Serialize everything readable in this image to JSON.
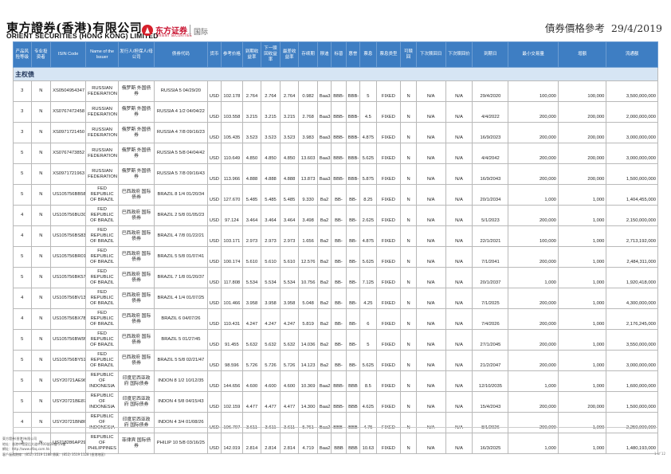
{
  "brand": {
    "name_cn": "東方證券(香港)有限公司",
    "name_en": "ORIENT SECURITIES (HONG KONG) LIMITED",
    "partner_cn": "东方证券",
    "partner_sub": "ORIENT SECURITIES",
    "intl": "国际"
  },
  "title": {
    "text": "債券價格參考",
    "date": "29/4/2019"
  },
  "columns": [
    "产品风险等级",
    "专业投资者",
    "ISIN Code",
    "Name of the Issuer",
    "发行人/担保人/母公司",
    "债券代码",
    "货币",
    "参考价格",
    "到期收益率",
    "下一赎回收益率",
    "最差收益率",
    "存续期",
    "穆迪",
    "标普",
    "惠誉",
    "票息",
    "票息类型",
    "可赎回",
    "下次赎回日",
    "下次赎回价",
    "到期日",
    "最小交易量",
    "增额",
    "流通额"
  ],
  "section": "主权债",
  "rows": [
    {
      "risk": "3",
      "pro": "N",
      "isin": "XS0504954347",
      "issuer": "RUSSIAN FEDERATION",
      "guarantor": "俄罗斯 外国债券",
      "ticker": "RUSSIA 5 04/29/20",
      "ccy": "USD",
      "price": "102.178",
      "ytm": "2.764",
      "ytc": "2.764",
      "ytw": "2.764",
      "dur": "0.982",
      "moody": "Baa3",
      "sp": "BBB-",
      "fitch": "BBB-",
      "cpn": "5",
      "ctype": "FIXED",
      "call": "N",
      "ncd": "N/A",
      "ncp": "N/A",
      "mat": "29/4/2020",
      "min": "100,000",
      "inc": "100,000",
      "out": "3,500,000,000"
    },
    {
      "risk": "3",
      "pro": "N",
      "isin": "XS0767472458",
      "issuer": "RUSSIAN FEDERATION",
      "guarantor": "俄罗斯 外国债券",
      "ticker": "RUSSIA 4 1/2 04/04/22",
      "ccy": "USD",
      "price": "103.558",
      "ytm": "3.215",
      "ytc": "3.215",
      "ytw": "3.215",
      "dur": "2.768",
      "moody": "Baa3",
      "sp": "BBB-",
      "fitch": "BBB-",
      "cpn": "4.5",
      "ctype": "FIXED",
      "call": "N",
      "ncd": "N/A",
      "ncp": "N/A",
      "mat": "4/4/2022",
      "min": "200,000",
      "inc": "200,000",
      "out": "2,000,000,000"
    },
    {
      "risk": "3",
      "pro": "N",
      "isin": "XS0971721450",
      "issuer": "RUSSIAN FEDERATION",
      "guarantor": "俄罗斯 外国债券",
      "ticker": "RUSSIA 4 7/8 09/16/23",
      "ccy": "USD",
      "price": "105.435",
      "ytm": "3.523",
      "ytc": "3.523",
      "ytw": "3.523",
      "dur": "3.983",
      "moody": "Baa3",
      "sp": "BBB-",
      "fitch": "BBB-",
      "cpn": "4.875",
      "ctype": "FIXED",
      "call": "N",
      "ncd": "N/A",
      "ncp": "N/A",
      "mat": "16/9/2023",
      "min": "200,000",
      "inc": "200,000",
      "out": "3,000,000,000"
    },
    {
      "risk": "5",
      "pro": "N",
      "isin": "XS0767473852",
      "issuer": "RUSSIAN FEDERATION",
      "guarantor": "俄罗斯 外国债券",
      "ticker": "RUSSIA 5 5/8 04/04/42",
      "ccy": "USD",
      "price": "110.649",
      "ytm": "4.850",
      "ytc": "4.850",
      "ytw": "4.850",
      "dur": "13.603",
      "moody": "Baa3",
      "sp": "BBB-",
      "fitch": "BBB-",
      "cpn": "5.625",
      "ctype": "FIXED",
      "call": "N",
      "ncd": "N/A",
      "ncp": "N/A",
      "mat": "4/4/2042",
      "min": "200,000",
      "inc": "200,000",
      "out": "3,000,000,000"
    },
    {
      "risk": "5",
      "pro": "N",
      "isin": "XS0971721963",
      "issuer": "RUSSIAN FEDERATION",
      "guarantor": "俄罗斯 外国债券",
      "ticker": "RUSSIA 5 7/8 09/16/43",
      "ccy": "USD",
      "price": "113.966",
      "ytm": "4.888",
      "ytc": "4.888",
      "ytw": "4.888",
      "dur": "13.873",
      "moody": "Baa3",
      "sp": "BBB-",
      "fitch": "BBB-",
      "cpn": "5.875",
      "ctype": "FIXED",
      "call": "N",
      "ncd": "N/A",
      "ncp": "N/A",
      "mat": "16/9/2043",
      "min": "200,000",
      "inc": "200,000",
      "out": "1,500,000,000"
    },
    {
      "risk": "5",
      "pro": "N",
      "isin": "US105756BB58",
      "issuer": "FED REPUBLIC OF BRAZIL",
      "guarantor": "巴西政府 国际债券",
      "ticker": "BRAZIL 8 1/4 01/20/34",
      "ccy": "USD",
      "price": "127.670",
      "ytm": "5.485",
      "ytc": "5.485",
      "ytw": "5.485",
      "dur": "9.330",
      "moody": "Ba2",
      "sp": "BB-",
      "fitch": "BB-",
      "cpn": "8.25",
      "ctype": "FIXED",
      "call": "N",
      "ncd": "N/A",
      "ncp": "N/A",
      "mat": "20/1/2034",
      "min": "1,000",
      "inc": "1,000",
      "out": "1,404,455,000"
    },
    {
      "risk": "4",
      "pro": "N",
      "isin": "US105756BU30",
      "issuer": "FED REPUBLIC OF BRAZIL",
      "guarantor": "巴西政府 国际债券",
      "ticker": "BRAZIL 2 5/8 01/05/23",
      "ccy": "USD",
      "price": "97.124",
      "ytm": "3.464",
      "ytc": "3.464",
      "ytw": "3.464",
      "dur": "3.498",
      "moody": "Ba2",
      "sp": "BB-",
      "fitch": "BB-",
      "cpn": "2.625",
      "ctype": "FIXED",
      "call": "N",
      "ncd": "N/A",
      "ncp": "N/A",
      "mat": "5/1/2023",
      "min": "200,000",
      "inc": "1,000",
      "out": "2,150,000,000"
    },
    {
      "risk": "4",
      "pro": "N",
      "isin": "US105756BS83",
      "issuer": "FED REPUBLIC OF BRAZIL",
      "guarantor": "巴西政府 国际债券",
      "ticker": "BRAZIL 4 7/8 01/22/21",
      "ccy": "USD",
      "price": "103.171",
      "ytm": "2.973",
      "ytc": "2.973",
      "ytw": "2.973",
      "dur": "1.656",
      "moody": "Ba2",
      "sp": "BB-",
      "fitch": "BB-",
      "cpn": "4.875",
      "ctype": "FIXED",
      "call": "N",
      "ncd": "N/A",
      "ncp": "N/A",
      "mat": "22/1/2021",
      "min": "100,000",
      "inc": "1,000",
      "out": "2,713,192,000"
    },
    {
      "risk": "5",
      "pro": "N",
      "isin": "US105756BR01",
      "issuer": "FED REPUBLIC OF BRAZIL",
      "guarantor": "巴西政府 国际债券",
      "ticker": "BRAZIL 5 5/8 01/07/41",
      "ccy": "USD",
      "price": "100.174",
      "ytm": "5.610",
      "ytc": "5.610",
      "ytw": "5.610",
      "dur": "12.576",
      "moody": "Ba2",
      "sp": "BB-",
      "fitch": "BB-",
      "cpn": "5.625",
      "ctype": "FIXED",
      "call": "N",
      "ncd": "N/A",
      "ncp": "N/A",
      "mat": "7/1/2041",
      "min": "200,000",
      "inc": "1,000",
      "out": "2,484,311,000"
    },
    {
      "risk": "5",
      "pro": "N",
      "isin": "US105756BK57",
      "issuer": "FED REPUBLIC OF BRAZIL",
      "guarantor": "巴西政府 国际债券",
      "ticker": "BRAZIL 7 1/8 01/20/37",
      "ccy": "USD",
      "price": "117.808",
      "ytm": "5.534",
      "ytc": "5.534",
      "ytw": "5.534",
      "dur": "10.756",
      "moody": "Ba2",
      "sp": "BB-",
      "fitch": "BB-",
      "cpn": "7.125",
      "ctype": "FIXED",
      "call": "N",
      "ncd": "N/A",
      "ncp": "N/A",
      "mat": "20/1/2037",
      "min": "1,000",
      "inc": "1,000",
      "out": "1,920,418,000"
    },
    {
      "risk": "4",
      "pro": "N",
      "isin": "US105756BV13",
      "issuer": "FED REPUBLIC OF BRAZIL",
      "guarantor": "巴西政府 国际债券",
      "ticker": "BRAZIL 4 1/4 01/07/25",
      "ccy": "USD",
      "price": "101.466",
      "ytm": "3.958",
      "ytc": "3.958",
      "ytw": "3.958",
      "dur": "5.048",
      "moody": "Ba2",
      "sp": "BB-",
      "fitch": "BB-",
      "cpn": "4.25",
      "ctype": "FIXED",
      "call": "N",
      "ncd": "N/A",
      "ncp": "N/A",
      "mat": "7/1/2025",
      "min": "200,000",
      "inc": "1,000",
      "out": "4,300,000,000"
    },
    {
      "risk": "4",
      "pro": "N",
      "isin": "US105756BX78",
      "issuer": "FED REPUBLIC OF BRAZIL",
      "guarantor": "巴西政府 国际债券",
      "ticker": "BRAZIL 6 04/07/26",
      "ccy": "USD",
      "price": "110.431",
      "ytm": "4.247",
      "ytc": "4.247",
      "ytw": "4.247",
      "dur": "5.819",
      "moody": "Ba2",
      "sp": "BB-",
      "fitch": "BB-",
      "cpn": "6",
      "ctype": "FIXED",
      "call": "N",
      "ncd": "N/A",
      "ncp": "N/A",
      "mat": "7/4/2026",
      "min": "200,000",
      "inc": "1,000",
      "out": "2,176,245,000"
    },
    {
      "risk": "5",
      "pro": "N",
      "isin": "US105756BW95",
      "issuer": "FED REPUBLIC OF BRAZIL",
      "guarantor": "巴西政府 国际债券",
      "ticker": "BRAZIL 5 01/27/45",
      "ccy": "USD",
      "price": "91.455",
      "ytm": "5.632",
      "ytc": "5.632",
      "ytw": "5.632",
      "dur": "14.036",
      "moody": "Ba2",
      "sp": "BB-",
      "fitch": "BB-",
      "cpn": "5",
      "ctype": "FIXED",
      "call": "N",
      "ncd": "N/A",
      "ncp": "N/A",
      "mat": "27/1/2045",
      "min": "200,000",
      "inc": "1,000",
      "out": "3,550,000,000"
    },
    {
      "risk": "5",
      "pro": "N",
      "isin": "US105756BY51",
      "issuer": "FED REPUBLIC OF BRAZIL",
      "guarantor": "巴西政府 国际债券",
      "ticker": "BRAZIL 5 5/8 02/21/47",
      "ccy": "USD",
      "price": "98.596",
      "ytm": "5.726",
      "ytc": "5.726",
      "ytw": "5.726",
      "dur": "14.123",
      "moody": "Ba2",
      "sp": "BB-",
      "fitch": "BB-",
      "cpn": "5.625",
      "ctype": "FIXED",
      "call": "N",
      "ncd": "N/A",
      "ncp": "N/A",
      "mat": "21/2/2047",
      "min": "200,000",
      "inc": "1,000",
      "out": "3,000,000,000"
    },
    {
      "risk": "5",
      "pro": "N",
      "isin": "USY20721AE96",
      "issuer": "REPUBLIC OF INDONESIA",
      "guarantor": "印度尼西亚政府 国际债券",
      "ticker": "INDON 8 1/2 10/12/35",
      "ccy": "USD",
      "price": "144.656",
      "ytm": "4.600",
      "ytc": "4.600",
      "ytw": "4.600",
      "dur": "10.369",
      "moody": "Baa2",
      "sp": "BBB-",
      "fitch": "BBB",
      "cpn": "8.5",
      "ctype": "FIXED",
      "call": "N",
      "ncd": "N/A",
      "ncp": "N/A",
      "mat": "12/10/2035",
      "min": "1,000",
      "inc": "1,000",
      "out": "1,600,000,000"
    },
    {
      "risk": "5",
      "pro": "N",
      "isin": "USY20721BE87",
      "issuer": "REPUBLIC OF INDONESIA",
      "guarantor": "印度尼西亚政府 国际债券",
      "ticker": "INDON 4 5/8 04/15/43",
      "ccy": "USD",
      "price": "102.159",
      "ytm": "4.477",
      "ytc": "4.477",
      "ytw": "4.477",
      "dur": "14.300",
      "moody": "Baa2",
      "sp": "BBB-",
      "fitch": "BBB",
      "cpn": "4.625",
      "ctype": "FIXED",
      "call": "N",
      "ncd": "N/A",
      "ncp": "N/A",
      "mat": "15/4/2043",
      "min": "200,000",
      "inc": "200,000",
      "out": "1,500,000,000"
    },
    {
      "risk": "4",
      "pro": "N",
      "isin": "USY20721BN86",
      "issuer": "REPUBLIC OF INDONESIA",
      "guarantor": "印度尼西亚政府 国际债券",
      "ticker": "INDON 4 3/4 01/08/26",
      "ccy": "USD",
      "price": "106.707",
      "ytm": "3.611",
      "ytc": "3.611",
      "ytw": "3.611",
      "dur": "5.761",
      "moody": "Baa2",
      "sp": "BBB-",
      "fitch": "BBB",
      "cpn": "4.75",
      "ctype": "FIXED",
      "call": "N",
      "ncd": "N/A",
      "ncp": "N/A",
      "mat": "8/1/2026",
      "min": "200,000",
      "inc": "1,000",
      "out": "2,250,000,000"
    },
    {
      "risk": "3",
      "pro": "N",
      "isin": "US718286AP29",
      "issuer": "REPUBLIC OF PHILIPPINES",
      "guarantor": "菲律宾 国际债券",
      "ticker": "PHILIP 10 5/8 03/16/25",
      "ccy": "USD",
      "price": "142.019",
      "ytm": "2.814",
      "ytc": "2.814",
      "ytw": "2.814",
      "dur": "4.719",
      "moody": "Baa2",
      "sp": "BBB",
      "fitch": "BBB",
      "cpn": "10.63",
      "ctype": "FIXED",
      "call": "N",
      "ncd": "N/A",
      "ncp": "N/A",
      "mat": "16/3/2025",
      "min": "1,000",
      "inc": "1,000",
      "out": "1,480,193,000"
    }
  ],
  "footer": [
    "東方證券(香港)有限公司",
    "地址：香港中環皇后大道中100號28樓-29樓",
    "網址：http://www.dfzq.com.hk",
    "客戶服務熱線：(852) 3519 1188  傳真：(852) 3519 1128  (香港地區)"
  ],
  "page_no": "1 of 12"
}
